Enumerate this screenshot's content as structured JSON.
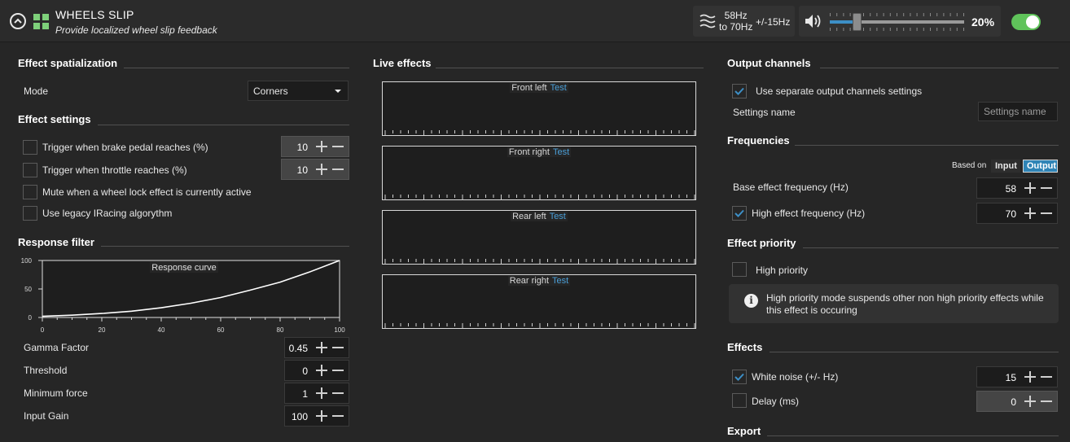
{
  "header": {
    "title": "WHEELS SLIP",
    "subtitle": "Provide localized wheel slip feedback",
    "freq_from": "58Hz",
    "freq_to": "to 70Hz",
    "freq_pm": "+/-15Hz",
    "volume_pct": "20%",
    "volume_level": 0.2,
    "enabled": true
  },
  "spatialization": {
    "section_title": "Effect spatialization",
    "mode_label": "Mode",
    "mode_value": "Corners"
  },
  "effect_settings": {
    "section_title": "Effect settings",
    "items": [
      {
        "label": "Trigger when brake pedal reaches (%)",
        "value": "10"
      },
      {
        "label": "Trigger when throttle reaches (%)",
        "value": "10"
      },
      {
        "label": "Mute when a wheel lock effect is currently active"
      },
      {
        "label": "Use legacy IRacing algorythm"
      }
    ]
  },
  "response_filter": {
    "section_title": "Response filter",
    "fields": [
      {
        "label": "Gamma Factor",
        "value": "0.45"
      },
      {
        "label": "Threshold",
        "value": "0"
      },
      {
        "label": "Minimum force",
        "value": "1"
      },
      {
        "label": "Input Gain",
        "value": "100"
      }
    ]
  },
  "chart_data": {
    "type": "line",
    "title": "Response curve",
    "xlabel": "",
    "ylabel": "",
    "xlim": [
      0,
      100
    ],
    "ylim": [
      0,
      100
    ],
    "x_ticks": [
      "0",
      "20",
      "40",
      "60",
      "80",
      "100"
    ],
    "y_ticks": [
      "100",
      "50",
      "0"
    ],
    "x": [
      0,
      10,
      20,
      30,
      40,
      50,
      60,
      70,
      80,
      90,
      100
    ],
    "y": [
      2,
      4,
      7,
      11,
      17,
      25,
      35,
      48,
      62,
      80,
      100
    ]
  },
  "live_effects": {
    "section_title": "Live effects",
    "test_label": "Test",
    "channels": [
      "Front left",
      "Front right",
      "Rear left",
      "Rear right"
    ]
  },
  "output_channels": {
    "section_title": "Output channels",
    "separate_label": "Use separate output channels settings",
    "settings_name_label": "Settings name",
    "settings_name_placeholder": "Settings name"
  },
  "frequencies": {
    "section_title": "Frequencies",
    "based_on_label": "Based on",
    "input_label": "Input",
    "output_label": "Output",
    "base_label": "Base effect frequency (Hz)",
    "base_value": "58",
    "high_label": "High effect frequency (Hz)",
    "high_value": "70"
  },
  "priority": {
    "section_title": "Effect priority",
    "high_label": "High priority",
    "info_text": "High priority mode suspends other non high priority effects while this effect is occuring"
  },
  "effects": {
    "section_title": "Effects",
    "white_noise_label": "White noise (+/- Hz)",
    "white_noise_value": "15",
    "delay_label": "Delay (ms)",
    "delay_value": "0"
  },
  "export": {
    "section_title": "Export"
  },
  "colors": {
    "accent": "#3d8fc6",
    "toggle_on": "#5fc35a",
    "test_link": "#4a9fd8"
  }
}
